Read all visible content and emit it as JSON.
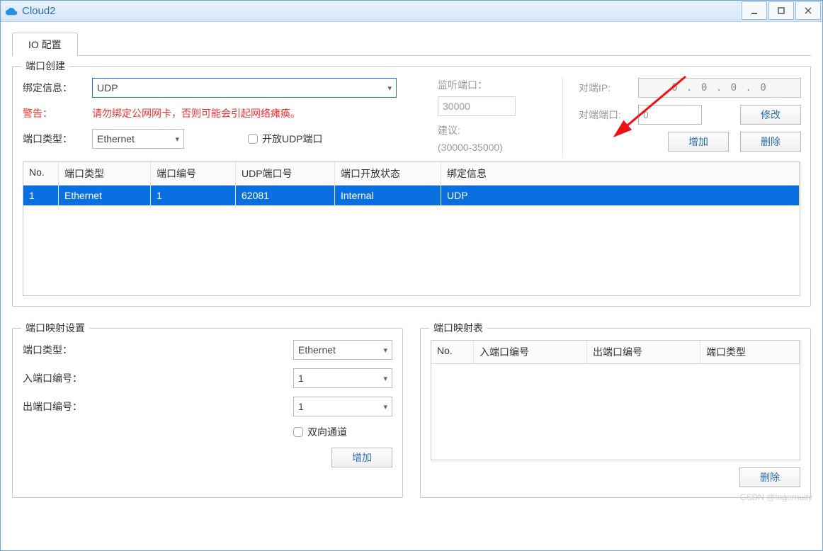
{
  "window": {
    "title": "Cloud2"
  },
  "tab": {
    "label": "IO 配置"
  },
  "portCreate": {
    "legend": "端口创建",
    "bindLabel": "绑定信息：",
    "bindValue": "UDP",
    "warningLabel": "警告：",
    "warningText": "请勿绑定公网网卡，否则可能会引起网络瘫痪。",
    "portTypeLabel": "端口类型：",
    "portTypeValue": "Ethernet",
    "openUdpLabel": "开放UDP端口",
    "listenLabel": "监听端口：",
    "listenValue": "30000",
    "suggestLabel": "建议:",
    "suggestRange": "(30000-35000)",
    "peerIpLabel": "对端IP:",
    "peerIpValue": "0   .   0   .   0   .   0",
    "peerPortLabel": "对端端口:",
    "peerPortValue": "0",
    "modifyBtn": "修改",
    "addBtn": "增加",
    "deleteBtn": "删除",
    "cols": {
      "no": "No.",
      "type": "端口类型",
      "num": "端口编号",
      "udp": "UDP端口号",
      "state": "端口开放状态",
      "bind": "绑定信息"
    },
    "rows": [
      {
        "no": "1",
        "type": "Ethernet",
        "num": "1",
        "udp": "62081",
        "state": "Internal",
        "bind": "UDP"
      }
    ]
  },
  "mapSettings": {
    "legend": "端口映射设置",
    "portTypeLabel": "端口类型：",
    "portTypeValue": "Ethernet",
    "inLabel": "入端口编号：",
    "inValue": "1",
    "outLabel": "出端口编号：",
    "outValue": "1",
    "biDirLabel": "双向通道",
    "addBtn": "增加"
  },
  "mapTable": {
    "legend": "端口映射表",
    "cols": {
      "no": "No.",
      "in": "入端口编号",
      "out": "出端口编号",
      "type": "端口类型"
    },
    "deleteBtn": "删除"
  },
  "watermark": "CSDN @Ingernuity"
}
